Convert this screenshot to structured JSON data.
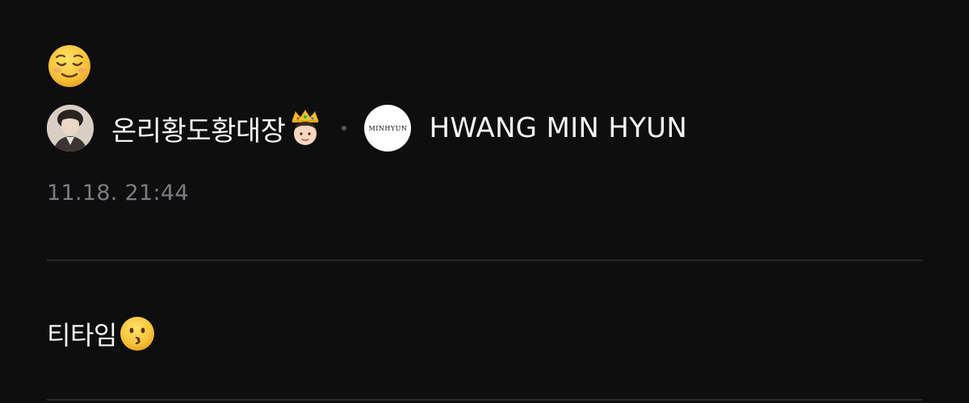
{
  "post": {
    "header_emoji": "relieved-face-emoji",
    "author": {
      "name": "온리황도황대장",
      "badge": "crown-face-emoji",
      "avatar": "user-avatar-photo"
    },
    "channel": {
      "logo_text": "MINHYUN",
      "name": "HWANG MIN HYUN"
    },
    "timestamp": "11.18. 21:44"
  },
  "message": {
    "text": "티타임",
    "emoji": "kissing-face-emoji"
  },
  "colors": {
    "background": "#0e0e0f",
    "text_primary": "#f4f4f4",
    "text_secondary": "#7c7c80",
    "divider": "#2a2a2c",
    "emoji_yellow": "#f6c33a"
  }
}
